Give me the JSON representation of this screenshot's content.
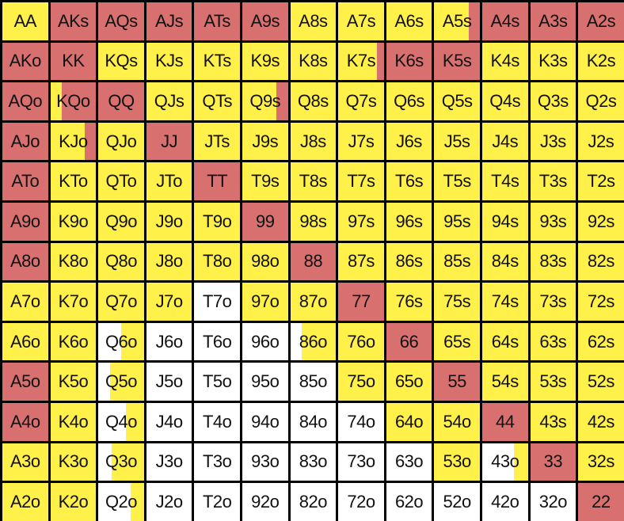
{
  "colors": {
    "raise": "#D97070",
    "call": "#FFF04A",
    "fold": "#FFFFFF",
    "border": "#000000"
  },
  "ranks": [
    "A",
    "K",
    "Q",
    "J",
    "T",
    "9",
    "8",
    "7",
    "6",
    "5",
    "4",
    "3",
    "2"
  ],
  "grid": [
    [
      {
        "label": "AA",
        "color": "yellow"
      },
      {
        "label": "AKs",
        "color": "red"
      },
      {
        "label": "AQs",
        "color": "red"
      },
      {
        "label": "AJs",
        "color": "red"
      },
      {
        "label": "ATs",
        "color": "red"
      },
      {
        "label": "A9s",
        "color": "red"
      },
      {
        "label": "A8s",
        "color": "yellow"
      },
      {
        "label": "A7s",
        "color": "yellow"
      },
      {
        "label": "A6s",
        "color": "yellow"
      },
      {
        "label": "A5s",
        "color": "yellow",
        "split": {
          "color": "red",
          "fraction": 0.25
        }
      },
      {
        "label": "A4s",
        "color": "red"
      },
      {
        "label": "A3s",
        "color": "red"
      },
      {
        "label": "A2s",
        "color": "red"
      }
    ],
    [
      {
        "label": "AKo",
        "color": "red"
      },
      {
        "label": "KK",
        "color": "red"
      },
      {
        "label": "KQs",
        "color": "yellow"
      },
      {
        "label": "KJs",
        "color": "yellow"
      },
      {
        "label": "KTs",
        "color": "yellow"
      },
      {
        "label": "K9s",
        "color": "yellow"
      },
      {
        "label": "K8s",
        "color": "yellow"
      },
      {
        "label": "K7s",
        "color": "yellow",
        "split": {
          "color": "red",
          "fraction": 0.15
        }
      },
      {
        "label": "K6s",
        "color": "red"
      },
      {
        "label": "K5s",
        "color": "red"
      },
      {
        "label": "K4s",
        "color": "yellow"
      },
      {
        "label": "K3s",
        "color": "yellow"
      },
      {
        "label": "K2s",
        "color": "yellow"
      }
    ],
    [
      {
        "label": "AQo",
        "color": "red"
      },
      {
        "label": "KQo",
        "color": "red",
        "split": {
          "color": "yellow",
          "fraction": 0.25,
          "side": "left"
        }
      },
      {
        "label": "QQ",
        "color": "red"
      },
      {
        "label": "QJs",
        "color": "yellow"
      },
      {
        "label": "QTs",
        "color": "yellow"
      },
      {
        "label": "Q9s",
        "color": "yellow",
        "split": {
          "color": "red",
          "fraction": 0.25
        }
      },
      {
        "label": "Q8s",
        "color": "yellow"
      },
      {
        "label": "Q7s",
        "color": "yellow"
      },
      {
        "label": "Q6s",
        "color": "yellow"
      },
      {
        "label": "Q5s",
        "color": "yellow"
      },
      {
        "label": "Q4s",
        "color": "yellow"
      },
      {
        "label": "Q3s",
        "color": "yellow"
      },
      {
        "label": "Q2s",
        "color": "yellow"
      }
    ],
    [
      {
        "label": "AJo",
        "color": "red"
      },
      {
        "label": "KJo",
        "color": "yellow",
        "split": {
          "color": "red",
          "fraction": 0.25
        }
      },
      {
        "label": "QJo",
        "color": "yellow"
      },
      {
        "label": "JJ",
        "color": "red"
      },
      {
        "label": "JTs",
        "color": "yellow"
      },
      {
        "label": "J9s",
        "color": "yellow"
      },
      {
        "label": "J8s",
        "color": "yellow"
      },
      {
        "label": "J7s",
        "color": "yellow"
      },
      {
        "label": "J6s",
        "color": "yellow"
      },
      {
        "label": "J5s",
        "color": "yellow"
      },
      {
        "label": "J4s",
        "color": "yellow"
      },
      {
        "label": "J3s",
        "color": "yellow"
      },
      {
        "label": "J2s",
        "color": "yellow"
      }
    ],
    [
      {
        "label": "ATo",
        "color": "red"
      },
      {
        "label": "KTo",
        "color": "yellow"
      },
      {
        "label": "QTo",
        "color": "yellow"
      },
      {
        "label": "JTo",
        "color": "yellow"
      },
      {
        "label": "TT",
        "color": "red"
      },
      {
        "label": "T9s",
        "color": "yellow"
      },
      {
        "label": "T8s",
        "color": "yellow"
      },
      {
        "label": "T7s",
        "color": "yellow"
      },
      {
        "label": "T6s",
        "color": "yellow"
      },
      {
        "label": "T5s",
        "color": "yellow"
      },
      {
        "label": "T4s",
        "color": "yellow"
      },
      {
        "label": "T3s",
        "color": "yellow"
      },
      {
        "label": "T2s",
        "color": "yellow"
      }
    ],
    [
      {
        "label": "A9o",
        "color": "red"
      },
      {
        "label": "K9o",
        "color": "yellow"
      },
      {
        "label": "Q9o",
        "color": "yellow"
      },
      {
        "label": "J9o",
        "color": "yellow"
      },
      {
        "label": "T9o",
        "color": "yellow"
      },
      {
        "label": "99",
        "color": "red"
      },
      {
        "label": "98s",
        "color": "yellow"
      },
      {
        "label": "97s",
        "color": "yellow"
      },
      {
        "label": "96s",
        "color": "yellow"
      },
      {
        "label": "95s",
        "color": "yellow"
      },
      {
        "label": "94s",
        "color": "yellow"
      },
      {
        "label": "93s",
        "color": "yellow"
      },
      {
        "label": "92s",
        "color": "yellow"
      }
    ],
    [
      {
        "label": "A8o",
        "color": "red"
      },
      {
        "label": "K8o",
        "color": "yellow"
      },
      {
        "label": "Q8o",
        "color": "yellow"
      },
      {
        "label": "J8o",
        "color": "yellow"
      },
      {
        "label": "T8o",
        "color": "yellow"
      },
      {
        "label": "98o",
        "color": "yellow"
      },
      {
        "label": "88",
        "color": "red"
      },
      {
        "label": "87s",
        "color": "yellow"
      },
      {
        "label": "86s",
        "color": "yellow"
      },
      {
        "label": "85s",
        "color": "yellow"
      },
      {
        "label": "84s",
        "color": "yellow"
      },
      {
        "label": "83s",
        "color": "yellow"
      },
      {
        "label": "82s",
        "color": "yellow"
      }
    ],
    [
      {
        "label": "A7o",
        "color": "yellow"
      },
      {
        "label": "K7o",
        "color": "yellow"
      },
      {
        "label": "Q7o",
        "color": "yellow"
      },
      {
        "label": "J7o",
        "color": "yellow"
      },
      {
        "label": "T7o",
        "color": "white"
      },
      {
        "label": "97o",
        "color": "yellow"
      },
      {
        "label": "87o",
        "color": "yellow"
      },
      {
        "label": "77",
        "color": "red"
      },
      {
        "label": "76s",
        "color": "yellow"
      },
      {
        "label": "75s",
        "color": "yellow"
      },
      {
        "label": "74s",
        "color": "yellow"
      },
      {
        "label": "73s",
        "color": "yellow"
      },
      {
        "label": "72s",
        "color": "yellow"
      }
    ],
    [
      {
        "label": "A6o",
        "color": "yellow"
      },
      {
        "label": "K6o",
        "color": "yellow"
      },
      {
        "label": "Q6o",
        "color": "white",
        "split": {
          "color": "yellow",
          "fraction": 0.5
        }
      },
      {
        "label": "J6o",
        "color": "white"
      },
      {
        "label": "T6o",
        "color": "white"
      },
      {
        "label": "96o",
        "color": "white"
      },
      {
        "label": "86o",
        "color": "white",
        "split": {
          "color": "yellow",
          "fraction": 0.75
        }
      },
      {
        "label": "76o",
        "color": "yellow"
      },
      {
        "label": "66",
        "color": "red"
      },
      {
        "label": "65s",
        "color": "yellow"
      },
      {
        "label": "64s",
        "color": "yellow"
      },
      {
        "label": "63s",
        "color": "yellow"
      },
      {
        "label": "62s",
        "color": "yellow"
      }
    ],
    [
      {
        "label": "A5o",
        "color": "red"
      },
      {
        "label": "K5o",
        "color": "yellow"
      },
      {
        "label": "Q5o",
        "color": "white",
        "split": {
          "color": "yellow",
          "fraction": 0.75
        }
      },
      {
        "label": "J5o",
        "color": "white"
      },
      {
        "label": "T5o",
        "color": "white"
      },
      {
        "label": "95o",
        "color": "white"
      },
      {
        "label": "85o",
        "color": "white"
      },
      {
        "label": "75o",
        "color": "yellow"
      },
      {
        "label": "65o",
        "color": "yellow"
      },
      {
        "label": "55",
        "color": "red"
      },
      {
        "label": "54s",
        "color": "yellow"
      },
      {
        "label": "53s",
        "color": "yellow"
      },
      {
        "label": "52s",
        "color": "yellow"
      }
    ],
    [
      {
        "label": "A4o",
        "color": "red"
      },
      {
        "label": "K4o",
        "color": "yellow"
      },
      {
        "label": "Q4o",
        "color": "white",
        "split": {
          "color": "yellow",
          "fraction": 0.4
        }
      },
      {
        "label": "J4o",
        "color": "white"
      },
      {
        "label": "T4o",
        "color": "white"
      },
      {
        "label": "94o",
        "color": "white"
      },
      {
        "label": "84o",
        "color": "white"
      },
      {
        "label": "74o",
        "color": "white"
      },
      {
        "label": "64o",
        "color": "yellow"
      },
      {
        "label": "54o",
        "color": "yellow"
      },
      {
        "label": "44",
        "color": "red"
      },
      {
        "label": "43s",
        "color": "yellow"
      },
      {
        "label": "42s",
        "color": "yellow"
      }
    ],
    [
      {
        "label": "A3o",
        "color": "yellow"
      },
      {
        "label": "K3o",
        "color": "yellow"
      },
      {
        "label": "Q3o",
        "color": "white",
        "split": {
          "color": "yellow",
          "fraction": 0.7
        }
      },
      {
        "label": "J3o",
        "color": "white"
      },
      {
        "label": "T3o",
        "color": "white"
      },
      {
        "label": "93o",
        "color": "white"
      },
      {
        "label": "83o",
        "color": "white"
      },
      {
        "label": "73o",
        "color": "white"
      },
      {
        "label": "63o",
        "color": "white"
      },
      {
        "label": "53o",
        "color": "yellow"
      },
      {
        "label": "43o",
        "color": "white",
        "split": {
          "color": "yellow",
          "fraction": 0.3
        }
      },
      {
        "label": "33",
        "color": "red"
      },
      {
        "label": "32s",
        "color": "yellow"
      }
    ],
    [
      {
        "label": "A2o",
        "color": "yellow"
      },
      {
        "label": "K2o",
        "color": "yellow"
      },
      {
        "label": "Q2o",
        "color": "white",
        "split": {
          "color": "yellow",
          "fraction": 0.3
        }
      },
      {
        "label": "J2o",
        "color": "white"
      },
      {
        "label": "T2o",
        "color": "white"
      },
      {
        "label": "92o",
        "color": "white"
      },
      {
        "label": "82o",
        "color": "white"
      },
      {
        "label": "72o",
        "color": "white"
      },
      {
        "label": "62o",
        "color": "white"
      },
      {
        "label": "52o",
        "color": "white"
      },
      {
        "label": "42o",
        "color": "white"
      },
      {
        "label": "32o",
        "color": "white"
      },
      {
        "label": "22",
        "color": "red"
      }
    ]
  ]
}
